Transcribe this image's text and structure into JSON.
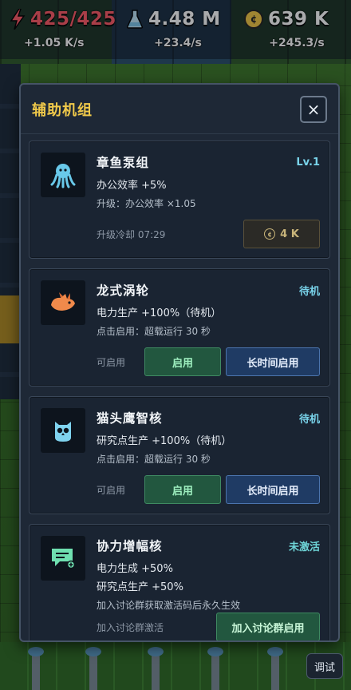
{
  "resources": {
    "power": {
      "value": "425/425",
      "rate": "+1.05 K/s",
      "icon": "lightning-bolt-icon"
    },
    "science": {
      "value": "4.48 M",
      "rate": "+23.4/s",
      "icon": "flask-icon"
    },
    "money": {
      "value": "639 K",
      "rate": "+245.3/s",
      "icon": "coin-icon"
    }
  },
  "modal": {
    "title": "辅助机组",
    "close_label": "×",
    "cards": [
      {
        "name": "章鱼泵组",
        "status": "Lv.1",
        "line1": "办公效率 +5%",
        "line2": "升级：办公效率 ×1.05",
        "footer_label": "升级冷却 07:29",
        "cost_coin": "¢",
        "cost_label": "4 K",
        "icon": "octopus-icon"
      },
      {
        "name": "龙式涡轮",
        "status": "待机",
        "line1": "电力生产 +100%（待机）",
        "line2": "点击启用：超载运行 30 秒",
        "footer_label": "可启用",
        "start_label": "启用",
        "long_label": "长时间启用",
        "icon": "dragon-icon"
      },
      {
        "name": "猫头鹰智核",
        "status": "待机",
        "line1": "研究点生产 +100%（待机）",
        "line2": "点击启用：超载运行 30 秒",
        "footer_label": "可启用",
        "start_label": "启用",
        "long_label": "长时间启用",
        "icon": "owl-icon"
      },
      {
        "name": "协力增幅核",
        "status": "未激活",
        "line1": "电力生成 +50%",
        "line1b": "研究点生产 +50%",
        "line2": "加入讨论群获取激活码后永久生效",
        "footer_label": "加入讨论群激活",
        "join_label": "加入讨论群启用",
        "icon": "chat-booster-icon"
      }
    ]
  },
  "debug_label": "调试",
  "colors": {
    "accent_title": "#f0c94a",
    "status_blue": "#79d3ea",
    "power_red": "#ff5a66"
  }
}
